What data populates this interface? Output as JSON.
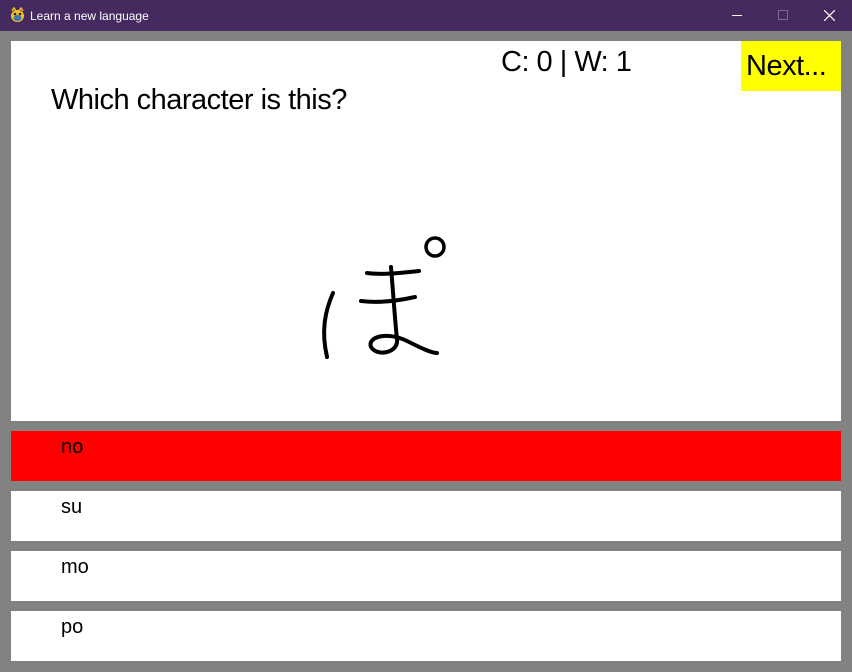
{
  "window": {
    "title": "Learn a new language",
    "icon": "pygame-snake-icon",
    "controls": [
      "minimize-icon",
      "maximize-icon",
      "close-icon"
    ]
  },
  "quiz": {
    "score_text": "C: 0 | W: 1",
    "next_label": "Next...",
    "prompt": "Which character is this?",
    "character": "ぽ"
  },
  "answers": [
    {
      "label": "no",
      "state": "wrong"
    },
    {
      "label": "su",
      "state": "neutral"
    },
    {
      "label": "mo",
      "state": "neutral"
    },
    {
      "label": "po",
      "state": "neutral"
    }
  ],
  "colors": {
    "titlebar": "#452a60",
    "background": "#828282",
    "panel": "#ffffff",
    "next_button": "#ffff00",
    "wrong_answer": "#ff0000"
  }
}
